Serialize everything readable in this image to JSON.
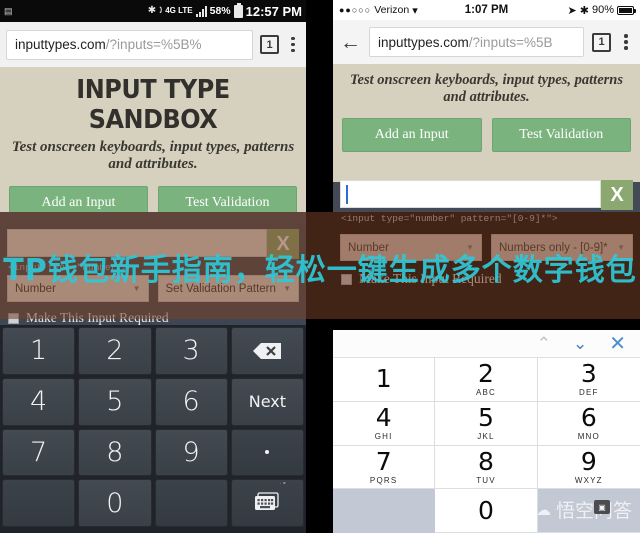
{
  "android": {
    "status_bar": {
      "keyboard_icon": "keyboard-icon",
      "bluetooth_icon": "bluetooth-icon",
      "mute_icon": "mute-icon",
      "network_label": "4G LTE",
      "battery_percent": "58%",
      "time": "12:57 PM"
    },
    "browser": {
      "url_main": "inputtypes.com",
      "url_query": "/?inputs=%5B%",
      "tab_count": "1",
      "menu_icon": "kebab-menu-icon"
    },
    "sandbox": {
      "title": "INPUT TYPE SANDBOX",
      "subtitle": "Test onscreen keyboards, input types, patterns and attributes.",
      "add_input_label": "Add an Input",
      "test_validation_label": "Test Validation"
    },
    "input_card": {
      "clear_label": "X",
      "code_line": "<input type=\"number\">",
      "type_select": "Number",
      "pattern_select": "Set Validation Pattern",
      "required_label": "Make This Input Required",
      "required_checked": false
    },
    "keyboard": {
      "keys": [
        {
          "label": "1",
          "kind": "digit"
        },
        {
          "label": "2",
          "kind": "digit"
        },
        {
          "label": "3",
          "kind": "digit"
        },
        {
          "label": "",
          "kind": "backspace"
        },
        {
          "label": "4",
          "kind": "digit"
        },
        {
          "label": "5",
          "kind": "digit"
        },
        {
          "label": "6",
          "kind": "digit"
        },
        {
          "label": "Next",
          "kind": "fn"
        },
        {
          "label": "7",
          "kind": "digit"
        },
        {
          "label": "8",
          "kind": "digit"
        },
        {
          "label": "9",
          "kind": "digit"
        },
        {
          "label": "",
          "kind": "dot"
        },
        {
          "label": "",
          "kind": "blank"
        },
        {
          "label": "0",
          "kind": "digit"
        },
        {
          "label": "",
          "kind": "blank"
        },
        {
          "label": "",
          "kind": "switch-keyboard"
        }
      ]
    }
  },
  "ios": {
    "status_bar": {
      "signal_dots": "●●○○○",
      "carrier": "Verizon",
      "wifi_icon": "wifi-icon",
      "time": "1:07 PM",
      "location_icon": "location-arrow-icon",
      "bluetooth_icon": "bluetooth-icon",
      "battery_percent": "90%"
    },
    "browser": {
      "back_icon": "back-arrow-icon",
      "url_main": "inputtypes.com",
      "url_query": "/?inputs=%5B",
      "tab_count": "1",
      "menu_icon": "kebab-menu-icon"
    },
    "sandbox": {
      "subtitle": "Test onscreen keyboards, input types, patterns and attributes.",
      "add_input_label": "Add an Input",
      "test_validation_label": "Test Validation"
    },
    "input_card": {
      "clear_label": "X",
      "code_line": "<input type=\"number\" pattern=\"[0-9]*\">",
      "type_select": "Number",
      "pattern_select": "Numbers only - [0-9]*",
      "required_label": "Make This Input Required",
      "required_checked": false
    },
    "keyboard": {
      "toolbar": {
        "prev_icon": "chevron-up-icon",
        "next_icon": "chevron-down-icon",
        "dismiss_icon": "close-icon"
      },
      "keys": [
        {
          "num": "1",
          "sub": ""
        },
        {
          "num": "2",
          "sub": "ABC"
        },
        {
          "num": "3",
          "sub": "DEF"
        },
        {
          "num": "4",
          "sub": "GHI"
        },
        {
          "num": "5",
          "sub": "JKL"
        },
        {
          "num": "6",
          "sub": "MNO"
        },
        {
          "num": "7",
          "sub": "PQRS"
        },
        {
          "num": "8",
          "sub": "TUV"
        },
        {
          "num": "9",
          "sub": "WXYZ"
        },
        {
          "num": "",
          "sub": ""
        },
        {
          "num": "0",
          "sub": ""
        },
        {
          "num": "",
          "sub": ""
        }
      ]
    }
  },
  "overlay": {
    "watermark": "TP钱包新手指南，轻松一键生成多个数字钱包",
    "watermark_color": "#2fc8d8",
    "brand": "悟空问答",
    "brand_icon": "cloud-icon"
  }
}
